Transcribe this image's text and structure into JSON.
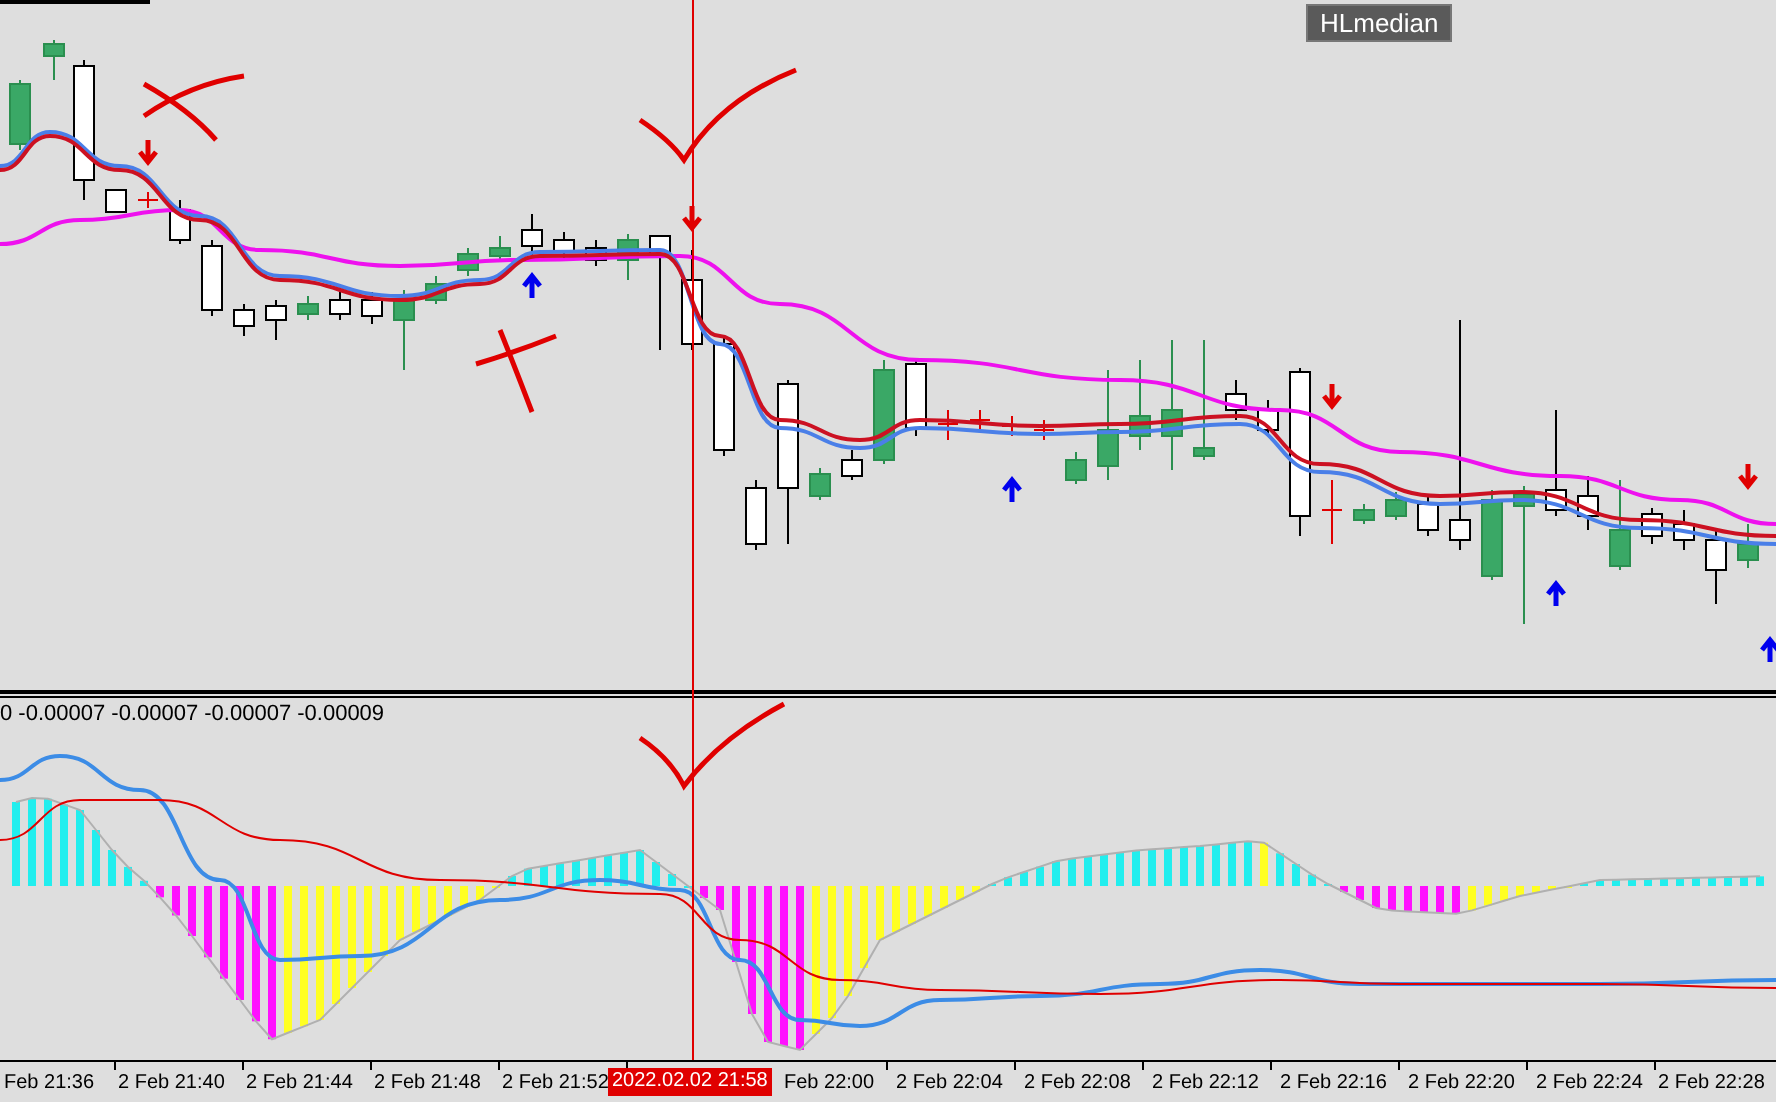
{
  "main_chart": {
    "button": "HLmedian"
  },
  "indicator": {
    "values": "0 -0.00007 -0.00007 -0.00007 -0.00009"
  },
  "time_axis": {
    "labels": [
      "Feb 21:36",
      "2 Feb 21:40",
      "2 Feb 21:44",
      "2 Feb 21:48",
      "2 Feb 21:52",
      "Feb 22:00",
      "2 Feb 22:04",
      "2 Feb 22:08",
      "2 Feb 22:12",
      "2 Feb 22:16",
      "2 Feb 22:20",
      "2 Feb 22:24",
      "2 Feb 22:28"
    ],
    "crosshair_label": "2022.02.02 21:58"
  }
}
